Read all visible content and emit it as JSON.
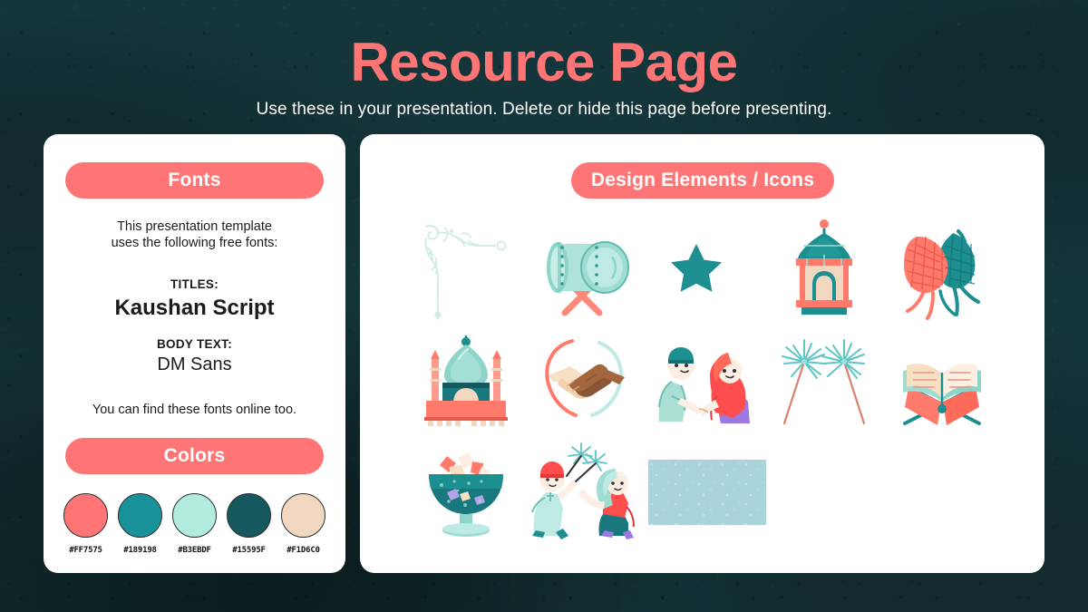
{
  "header": {
    "title": "Resource Page",
    "subtitle": "Use these in your presentation. Delete or hide this page before presenting."
  },
  "fonts_card": {
    "pill_label": "Fonts",
    "intro_line1": "This presentation template",
    "intro_line2": "uses the following free fonts:",
    "titles_label": "TITLES:",
    "titles_font": "Kaushan Script",
    "body_label": "BODY TEXT:",
    "body_font": "DM Sans",
    "footer_note": "You can find these fonts online too."
  },
  "colors_card": {
    "pill_label": "Colors",
    "swatches": [
      {
        "hex": "#FF7575",
        "label": "#FF7575"
      },
      {
        "hex": "#189198",
        "label": "#189198"
      },
      {
        "hex": "#B3EBDF",
        "label": "#B3EBDF"
      },
      {
        "hex": "#15595F",
        "label": "#15595F"
      },
      {
        "hex": "#F1D6C0",
        "label": "#F1D6C0"
      }
    ]
  },
  "icons_card": {
    "pill_label": "Design Elements / Icons",
    "items": [
      {
        "name": "ornamental-corner-flourish-icon"
      },
      {
        "name": "bedug-drum-icon"
      },
      {
        "name": "star-and-crescent-icon"
      },
      {
        "name": "lantern-icon"
      },
      {
        "name": "ketupat-icon"
      },
      {
        "name": "mosque-icon"
      },
      {
        "name": "handshake-icon"
      },
      {
        "name": "greeting-couple-icon"
      },
      {
        "name": "sparklers-icon"
      },
      {
        "name": "quran-on-rehal-icon"
      },
      {
        "name": "candy-bowl-icon"
      },
      {
        "name": "children-with-sparklers-icon"
      },
      {
        "name": "texture-swatch-icon"
      }
    ]
  },
  "palette": {
    "background": "#14363a",
    "accent_coral": "#FF7575",
    "teal": "#189198",
    "mint": "#B3EBDF",
    "deep_teal": "#15595F",
    "sand": "#F1D6C0",
    "card": "#ffffff"
  }
}
